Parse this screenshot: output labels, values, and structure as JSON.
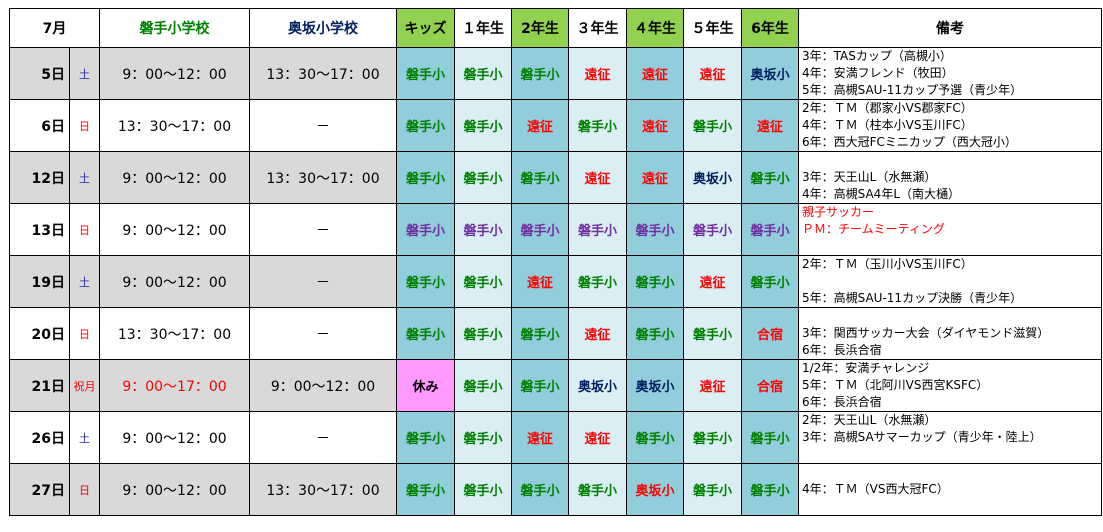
{
  "header": {
    "month": "7月",
    "iwate": "磐手小学校",
    "okusaka": "奥坂小学校",
    "kids": "キッズ",
    "g1": "１年生",
    "g2": "2年生",
    "g3": "３年生",
    "g4": "４年生",
    "g5": "５年生",
    "g6": "6年生",
    "notes": "備考"
  },
  "rows": [
    {
      "day": "5日",
      "wd": "土",
      "iwate": "9：00～12：00",
      "okusaka": "13：30～17：00",
      "cells": [
        "磐手小",
        "磐手小",
        "磐手小",
        "遠征",
        "遠征",
        "遠征",
        "奥坂小"
      ],
      "notes": [
        "3年：TASカップ（高槻小）",
        "4年：安満フレンド（牧田）",
        "5年：高槻SAU-11カップ予選（青少年）"
      ]
    },
    {
      "day": "6日",
      "wd": "日",
      "iwate": "13：30～17：00",
      "okusaka": "－",
      "cells": [
        "磐手小",
        "磐手小",
        "遠征",
        "磐手小",
        "遠征",
        "磐手小",
        "遠征"
      ],
      "notes": [
        "2年：ＴＭ（郡家小VS郡家FC）",
        "4年：ＴＭ（柱本小VS玉川FC）",
        "6年：西大冠FCミニカップ（西大冠小）"
      ]
    },
    {
      "day": "12日",
      "wd": "土",
      "iwate": "9：00～12：00",
      "okusaka": "13：30～17：00",
      "cells": [
        "磐手小",
        "磐手小",
        "磐手小",
        "遠征",
        "遠征",
        "奥坂小",
        "磐手小"
      ],
      "notes": [
        "",
        "3年：天王山L（水無瀬）",
        "4年：高槻SA4年L（南大樋）"
      ]
    },
    {
      "day": "13日",
      "wd": "日",
      "iwate": "9：00～12：00",
      "okusaka": "－",
      "cells": [
        "磐手小",
        "磐手小",
        "磐手小",
        "磐手小",
        "磐手小",
        "磐手小",
        "磐手小"
      ],
      "notes": [
        "親子サッカー",
        "ＰＭ：チームミーティング",
        ""
      ]
    },
    {
      "day": "19日",
      "wd": "土",
      "iwate": "9：00～12：00",
      "okusaka": "－",
      "cells": [
        "磐手小",
        "磐手小",
        "遠征",
        "磐手小",
        "磐手小",
        "遠征",
        "磐手小"
      ],
      "notes": [
        "2年：ＴＭ（玉川小VS玉川FC）",
        "",
        "5年：高槻SAU-11カップ決勝（青少年）"
      ]
    },
    {
      "day": "20日",
      "wd": "日",
      "iwate": "13：30～17：00",
      "okusaka": "－",
      "cells": [
        "磐手小",
        "磐手小",
        "磐手小",
        "遠征",
        "磐手小",
        "磐手小",
        "合宿"
      ],
      "notes": [
        "",
        "3年：関西サッカー大会（ダイヤモンド滋賀）",
        "6年：長浜合宿"
      ]
    },
    {
      "day": "21日",
      "wd": "祝月",
      "iwate": "9：00～17：00",
      "okusaka": "9：00～12：00",
      "cells": [
        "休み",
        "磐手小",
        "磐手小",
        "奥坂小",
        "奥坂小",
        "遠征",
        "合宿"
      ],
      "notes": [
        "1/2年：安満チャレンジ",
        "5年：ＴＭ（北阿川VS西宮KSFC）",
        "6年：長浜合宿"
      ]
    },
    {
      "day": "26日",
      "wd": "土",
      "iwate": "9：00～12：00",
      "okusaka": "－",
      "cells": [
        "磐手小",
        "磐手小",
        "遠征",
        "遠征",
        "磐手小",
        "磐手小",
        "磐手小"
      ],
      "notes": [
        "2年：天王山L（水無瀬）",
        "3年：高槻SAサマーカップ（青少年・陸上）",
        ""
      ]
    },
    {
      "day": "27日",
      "wd": "日",
      "iwate": "9：00～12：00",
      "okusaka": "13：30～17：00",
      "cells": [
        "磐手小",
        "磐手小",
        "磐手小",
        "磐手小",
        "奥坂小",
        "磐手小",
        "磐手小"
      ],
      "notes": [
        "",
        "4年：ＴＭ（VS西大冠FC）",
        ""
      ]
    }
  ]
}
